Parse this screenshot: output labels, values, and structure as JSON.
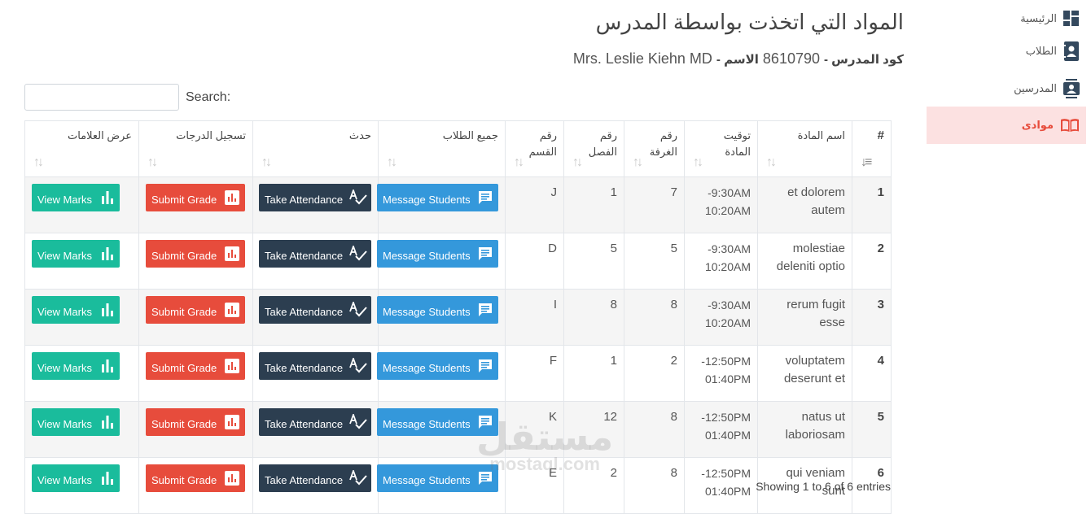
{
  "page": {
    "title": "المواد التي اتخذت بواسطة المدرس",
    "code_label": "كود المدرس -",
    "code_value": "8610790",
    "name_label": "الاسم -",
    "name_value": "Mrs. Leslie Kiehn MD"
  },
  "search": {
    "label": "Search:",
    "value": "",
    "placeholder": ""
  },
  "table": {
    "headers": {
      "num": "#",
      "subject": "اسم المادة",
      "time_1": "توقيت",
      "time_2": "المادة",
      "room_1": "رقم",
      "room_2": "الغرفة",
      "class_1": "رقم",
      "class_2": "الفصل",
      "section_1": "رقم",
      "section_2": "القسم",
      "students": "جميع الطلاب",
      "event": "حدث",
      "grades": "تسجيل الدرجات",
      "marks": "عرض العلامات"
    },
    "buttons": {
      "message": "Message Students",
      "attendance": "Take Attendance",
      "submit": "Submit Grade",
      "view": "View Marks"
    },
    "rows": [
      {
        "num": "1",
        "subject_1": "et dolorem",
        "subject_2": "autem",
        "time_1": "9:30AM-",
        "time_2": "10:20AM",
        "room": "7",
        "class": "1",
        "section": "J"
      },
      {
        "num": "2",
        "subject_1": "molestiae",
        "subject_2": "deleniti optio",
        "time_1": "9:30AM-",
        "time_2": "10:20AM",
        "room": "5",
        "class": "5",
        "section": "D"
      },
      {
        "num": "3",
        "subject_1": "rerum fugit",
        "subject_2": "esse",
        "time_1": "9:30AM-",
        "time_2": "10:20AM",
        "room": "8",
        "class": "8",
        "section": "I"
      },
      {
        "num": "4",
        "subject_1": "voluptatem",
        "subject_2": "deserunt et",
        "time_1": "12:50PM-",
        "time_2": "01:40PM",
        "room": "2",
        "class": "1",
        "section": "F"
      },
      {
        "num": "5",
        "subject_1": "natus ut",
        "subject_2": "laboriosam",
        "time_1": "12:50PM-",
        "time_2": "01:40PM",
        "room": "8",
        "class": "12",
        "section": "K"
      },
      {
        "num": "6",
        "subject_1": "qui veniam",
        "subject_2": "sunt",
        "time_1": "12:50PM-",
        "time_2": "01:40PM",
        "room": "8",
        "class": "2",
        "section": "E"
      }
    ]
  },
  "footer": {
    "info": "Showing 1 to 6 of 6 entries"
  },
  "watermark": {
    "arabic": "مستقل",
    "latin": "mostaql.com"
  },
  "sidebar": {
    "items": [
      {
        "label": "الرئيسية",
        "icon": "dashboard-icon"
      },
      {
        "label": "الطلاب",
        "icon": "contact-book-icon"
      },
      {
        "label": "المدرسين",
        "icon": "contact-card-icon"
      },
      {
        "label": "موادى",
        "icon": "book-icon"
      }
    ]
  },
  "colors": {
    "message": "#3498db",
    "attendance": "#2c3e50",
    "submit": "#e74c3c",
    "view": "#1abc9c",
    "active_bg": "#fce1e1",
    "active_text": "#e74c3c"
  }
}
